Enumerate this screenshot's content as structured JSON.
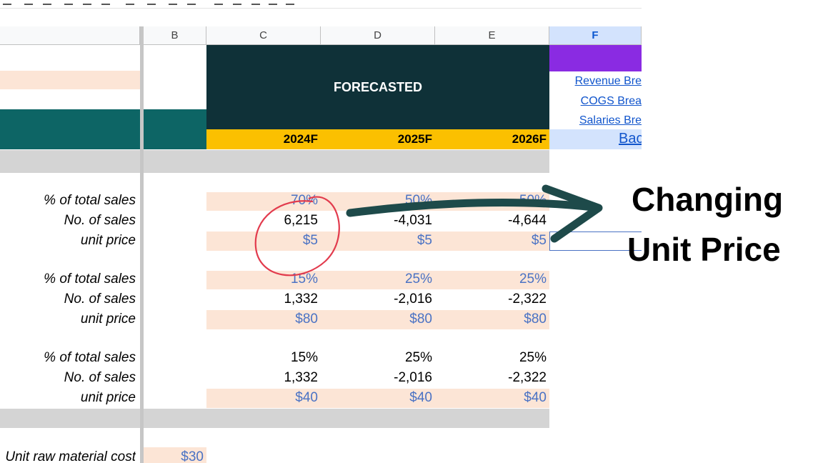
{
  "toolbar": {
    "icons": [
      "undo-icon",
      "redo-icon",
      "underline-icon",
      "strikethrough-icon",
      "borders-icon",
      "merge-icon",
      "align-left-icon",
      "align-center-icon",
      "wrap-icon",
      "rotate-icon",
      "link-icon",
      "comment-icon",
      "chart-icon",
      "filter-icon",
      "functions-icon"
    ]
  },
  "columns": {
    "b": "B",
    "c": "C",
    "d": "D",
    "e": "E",
    "f": "F"
  },
  "header": {
    "forecasted": "FORECASTED",
    "years": [
      "2024F",
      "2025F",
      "2026F"
    ]
  },
  "links": [
    "Revenue Bre",
    "COGS Brea",
    "Salaries Bre",
    "Bac"
  ],
  "section1": {
    "labels": [
      "% of total sales",
      "No. of sales",
      "unit price"
    ],
    "share": [
      "70%",
      "50%",
      "50%"
    ],
    "sales": [
      "6,215",
      "-4,031",
      "-4,644"
    ],
    "price": [
      "$5",
      "$5",
      "$5"
    ]
  },
  "section2": {
    "labels": [
      "% of total sales",
      "No. of sales",
      "unit price"
    ],
    "share": [
      "15%",
      "25%",
      "25%"
    ],
    "sales": [
      "1,332",
      "-2,016",
      "-2,322"
    ],
    "price": [
      "$80",
      "$80",
      "$80"
    ]
  },
  "section3": {
    "labels": [
      "% of total sales",
      "No. of sales",
      "unit price"
    ],
    "share": [
      "15%",
      "25%",
      "25%"
    ],
    "sales": [
      "1,332",
      "-2,016",
      "-2,322"
    ],
    "price": [
      "$40",
      "$40",
      "$40"
    ]
  },
  "bottom": {
    "label": "Unit raw material cost",
    "value": "$30"
  },
  "callout": {
    "line1": "Changing",
    "line2": "Unit Price"
  },
  "colors": {
    "teal": "#0d6565",
    "dark_teal": "#0f3138",
    "gold": "#fbc000",
    "purple": "#8a2be2",
    "peach": "#fce5d6",
    "annotation_red": "#e23b4d",
    "arrow": "#1e4a4a"
  }
}
